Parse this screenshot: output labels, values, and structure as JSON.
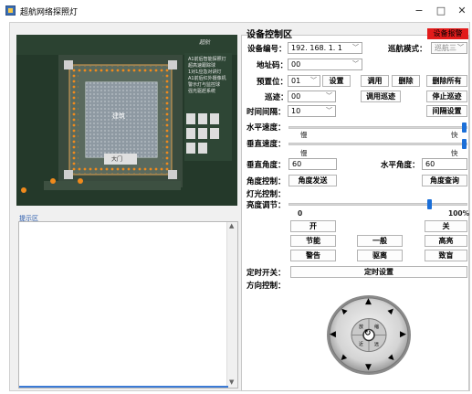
{
  "window": {
    "title": "超航网络探照灯",
    "minimize": "−",
    "maximize": "□",
    "close": "✕"
  },
  "map": {
    "top_title": "设备控制",
    "center_label": "建筑",
    "gate_label": "大门",
    "legend": [
      "A1前后智能探照灯",
      "超高速跟踪球",
      "1对1应急对讲灯",
      "A1前后红外摄像机",
      "警示灯与监控球",
      "强光驱赶系统"
    ],
    "logo": "超航"
  },
  "tip": {
    "label": "提示区"
  },
  "panel": {
    "group_title": "设备控制区",
    "alarm_button": "设备报警",
    "device_no_label": "设备编号：",
    "device_no_value": "192. 168. 1. 1",
    "cruise_mode_label": "巡航模式：",
    "cruise_mode_value": "巡航三",
    "address_label": "地址码：",
    "address_value": "00",
    "preset_label": "预置位：",
    "preset_value": "01",
    "btn_set": "设置",
    "btn_call": "调用",
    "btn_delete": "删除",
    "btn_delete_all": "删除所有",
    "patrol_label": "巡迹：",
    "patrol_value": "00",
    "btn_call_patrol": "调用巡迹",
    "btn_stop_patrol": "停止巡迹",
    "interval_label": "时间间隔：",
    "interval_value": "10",
    "btn_interval_set": "间隔设置",
    "h_speed_label": "水平速度：",
    "v_speed_label": "垂直速度：",
    "slow": "慢",
    "fast": "快",
    "h_speed_level": 1.0,
    "v_speed_level": 1.0,
    "v_angle_label": "垂直角度：",
    "v_angle_value": "60",
    "h_angle_label": "水平角度：",
    "h_angle_value": "60",
    "angle_ctrl_label": "角度控制：",
    "btn_angle_send": "角度发送",
    "btn_angle_query": "角度查询",
    "light_ctrl_label": "灯光控制：",
    "brightness_label": "亮度调节：",
    "brightness_min": "0",
    "brightness_max": "100%",
    "brightness_level": 0.8,
    "btn_on": "开",
    "btn_off": "关",
    "btn_energy": "节能",
    "btn_normal": "一般",
    "btn_high": "高亮",
    "btn_warn": "警告",
    "btn_repel": "驱离",
    "btn_blind": "致盲",
    "timer_label": "定时开关：",
    "btn_timer_set": "定时设置",
    "direction_label": "方向控制：",
    "dpad": {
      "zoom_in": "放",
      "zoom_out": "缩",
      "focus_near": "近",
      "focus_far": "远"
    }
  }
}
